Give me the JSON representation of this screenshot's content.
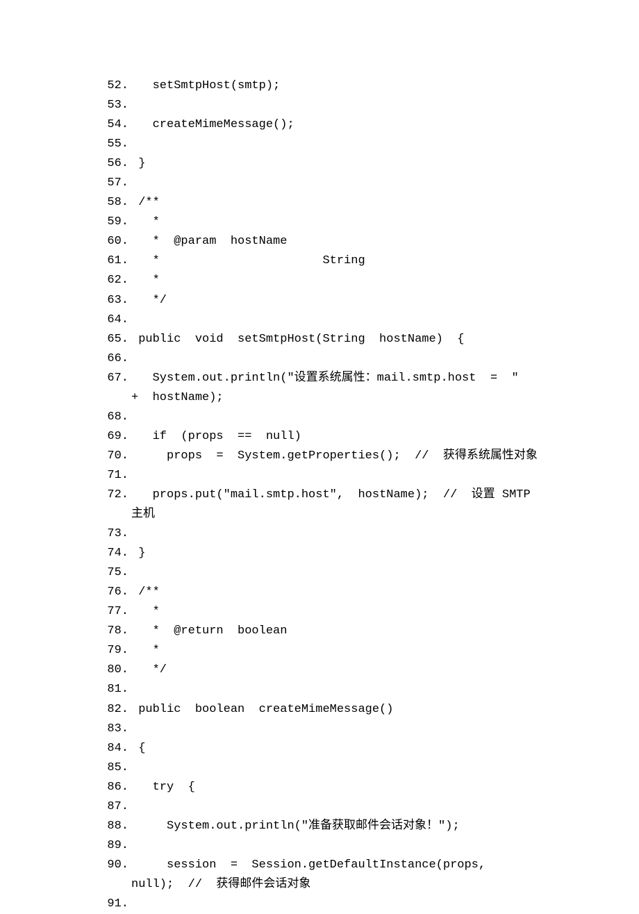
{
  "code": {
    "lines": [
      {
        "n": "52.",
        "t": "   setSmtpHost(smtp);  "
      },
      {
        "n": "53.",
        "t": ""
      },
      {
        "n": "54.",
        "t": "   createMimeMessage();  "
      },
      {
        "n": "55.",
        "t": ""
      },
      {
        "n": "56.",
        "t": " }  "
      },
      {
        "n": "57.",
        "t": ""
      },
      {
        "n": "58.",
        "t": " /**  "
      },
      {
        "n": "59.",
        "t": "   *  "
      },
      {
        "n": "60.",
        "t": "   *  @param  hostName  "
      },
      {
        "n": "61.",
        "t": "   *                       String  "
      },
      {
        "n": "62.",
        "t": "   *  "
      },
      {
        "n": "63.",
        "t": "   */  "
      },
      {
        "n": "64.",
        "t": ""
      },
      {
        "n": "65.",
        "t": " public  void  setSmtpHost(String  hostName)  {  "
      },
      {
        "n": "66.",
        "t": ""
      },
      {
        "n": "67.",
        "t": "   System.out.println(\"设置系统属性：mail.smtp.host  =  \"  +  hostName);  "
      },
      {
        "n": "68.",
        "t": ""
      },
      {
        "n": "69.",
        "t": "   if  (props  ==  null)  "
      },
      {
        "n": "70.",
        "t": "     props  =  System.getProperties();  //  获得系统属性对象  "
      },
      {
        "n": "71.",
        "t": ""
      },
      {
        "n": "72.",
        "t": "   props.put(\"mail.smtp.host\",  hostName);  //  设置 SMTP 主机  "
      },
      {
        "n": "73.",
        "t": ""
      },
      {
        "n": "74.",
        "t": " }  "
      },
      {
        "n": "75.",
        "t": ""
      },
      {
        "n": "76.",
        "t": " /**  "
      },
      {
        "n": "77.",
        "t": "   *  "
      },
      {
        "n": "78.",
        "t": "   *  @return  boolean  "
      },
      {
        "n": "79.",
        "t": "   *  "
      },
      {
        "n": "80.",
        "t": "   */  "
      },
      {
        "n": "81.",
        "t": ""
      },
      {
        "n": "82.",
        "t": " public  boolean  createMimeMessage()  "
      },
      {
        "n": "83.",
        "t": ""
      },
      {
        "n": "84.",
        "t": " {  "
      },
      {
        "n": "85.",
        "t": ""
      },
      {
        "n": "86.",
        "t": "   try  {  "
      },
      {
        "n": "87.",
        "t": ""
      },
      {
        "n": "88.",
        "t": "     System.out.println(\"准备获取邮件会话对象！\");  "
      },
      {
        "n": "89.",
        "t": ""
      },
      {
        "n": "90.",
        "t": "     session  =  Session.getDefaultInstance(props,  null);  //  获得邮件会话对象  "
      },
      {
        "n": "91.",
        "t": ""
      }
    ]
  }
}
